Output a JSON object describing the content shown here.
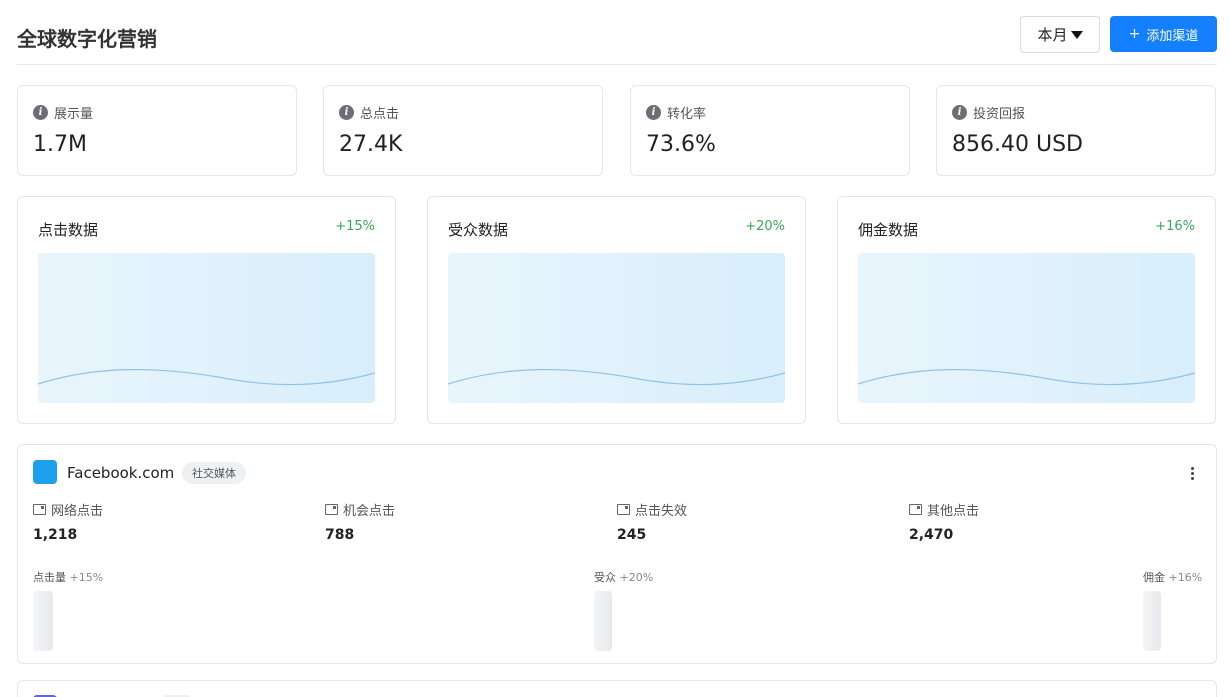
{
  "header": {
    "title": "全球数字化营销",
    "period_select": "本月",
    "add_channel_label": "添加渠道"
  },
  "stats": [
    {
      "label": "展示量",
      "value": "1.7M"
    },
    {
      "label": "总点击",
      "value": "27.4K"
    },
    {
      "label": "转化率",
      "value": "73.6%"
    },
    {
      "label": "投资回报",
      "value": "856.40 USD"
    }
  ],
  "charts": [
    {
      "title": "点击数据",
      "change": "+15%"
    },
    {
      "title": "受众数据",
      "change": "+20%"
    },
    {
      "title": "佣金数据",
      "change": "+16%"
    }
  ],
  "channel": {
    "name": "Facebook.com",
    "tag": "社交媒体",
    "logo_color": "#1e9fee",
    "metrics": [
      {
        "label": "网络点击",
        "value": "1,218"
      },
      {
        "label": "机会点击",
        "value": "788"
      },
      {
        "label": "点击失效",
        "value": "245"
      },
      {
        "label": "其他点击",
        "value": "2,470"
      }
    ],
    "bars": [
      {
        "label": "点击量",
        "change": "+15%"
      },
      {
        "label": "受众",
        "change": "+20%"
      },
      {
        "label": "佣金",
        "change": "+16%"
      }
    ]
  },
  "colors": {
    "accent": "#1480ff",
    "positive": "#3aa757",
    "second_channel_logo": "#6267d9"
  }
}
